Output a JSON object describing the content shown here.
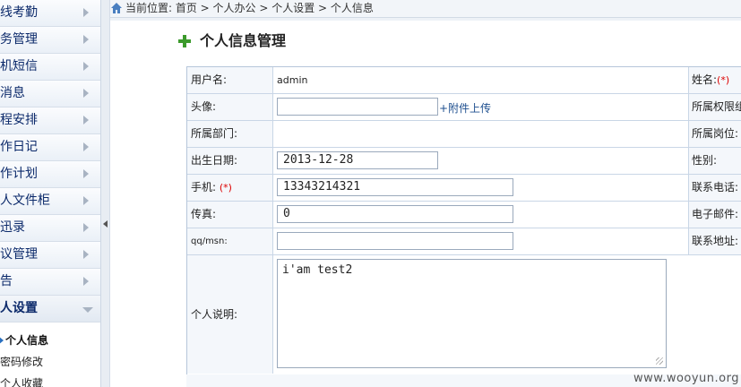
{
  "sidebar": {
    "items": [
      {
        "label": "线考勤"
      },
      {
        "label": "务管理"
      },
      {
        "label": "机短信"
      },
      {
        "label": "消息"
      },
      {
        "label": "程安排"
      },
      {
        "label": "作日记"
      },
      {
        "label": "作计划"
      },
      {
        "label": "人文件柜"
      },
      {
        "label": "迅录"
      },
      {
        "label": "议管理"
      },
      {
        "label": "告"
      },
      {
        "label": "人设置"
      }
    ],
    "sub_items": [
      {
        "label": "个人信息"
      },
      {
        "label": "密码修改"
      },
      {
        "label": "个人收藏"
      }
    ]
  },
  "breadcrumb": {
    "text": "当前位置: 首页 > 个人办公 > 个人设置 > 个人信息"
  },
  "page": {
    "title": "个人信息管理"
  },
  "form": {
    "required_mark": "(*)",
    "username_label": "用户名:",
    "username_value": "admin",
    "realname_label": "姓名:",
    "avatar_label": "头像:",
    "upload_link": "+附件上传",
    "permission_label": "所属权限组",
    "department_label": "所属部门:",
    "position_label": "所属岗位:",
    "birthday_label": "出生日期:",
    "birthday_value": "2013-12-28",
    "gender_label": "性别:",
    "mobile_label": "手机:",
    "mobile_value": "13343214321",
    "phone_label": "联系电话:",
    "fax_label": "传真:",
    "fax_value": "0",
    "email_label": "电子邮件:",
    "qq_label": "qq/msn:",
    "qq_value": "",
    "address_label": "联系地址:",
    "bio_label": "个人说明:",
    "bio_value": "i'am test2"
  },
  "watermark": "www.wooyun.org",
  "colors": {
    "menu_text": "#0c2a6b",
    "label_bg": "#f4f7fb",
    "border": "#c9d6e6",
    "required": "#dd0000",
    "link": "#1e4f8f"
  }
}
